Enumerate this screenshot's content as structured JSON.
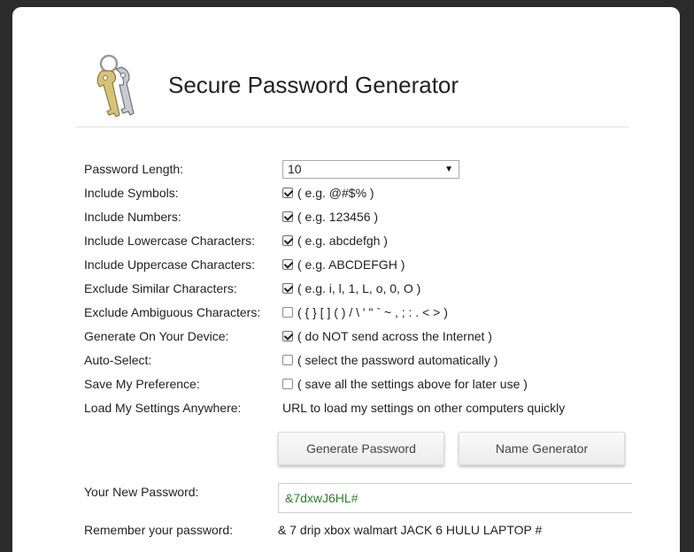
{
  "app": {
    "title": "Secure Password Generator"
  },
  "settings": [
    {
      "label": "Password Length:",
      "type": "select",
      "value": "10"
    },
    {
      "label": "Include Symbols:",
      "type": "checkbox",
      "checked": true,
      "hint": "( e.g. @#$% )"
    },
    {
      "label": "Include Numbers:",
      "type": "checkbox",
      "checked": true,
      "hint": "( e.g. 123456 )"
    },
    {
      "label": "Include Lowercase Characters:",
      "type": "checkbox",
      "checked": true,
      "hint": "( e.g. abcdefgh )"
    },
    {
      "label": "Include Uppercase Characters:",
      "type": "checkbox",
      "checked": true,
      "hint": "( e.g. ABCDEFGH )"
    },
    {
      "label": "Exclude Similar Characters:",
      "type": "checkbox",
      "checked": true,
      "hint": "( e.g. i, l, 1, L, o, 0, O )"
    },
    {
      "label": "Exclude Ambiguous Characters:",
      "type": "checkbox",
      "checked": false,
      "hint": "( { } [ ] ( ) / \\ ' \" ` ~ , ; : . < > )"
    },
    {
      "label": "Generate On Your Device:",
      "type": "checkbox",
      "checked": true,
      "hint": "( do NOT send across the Internet )"
    },
    {
      "label": "Auto-Select:",
      "type": "checkbox",
      "checked": false,
      "hint": "( select the password automatically )"
    },
    {
      "label": "Save My Preference:",
      "type": "checkbox",
      "checked": false,
      "hint": "( save all the settings above for later use )"
    },
    {
      "label": "Load My Settings Anywhere:",
      "type": "text",
      "hint": "URL to load my settings on other computers quickly"
    }
  ],
  "buttons": {
    "generate": "Generate Password",
    "name_generator": "Name Generator"
  },
  "result": {
    "new_password_label": "Your New Password:",
    "new_password_value": "&7dxwJ6HL#",
    "remember_label": "Remember your password:",
    "remember_value": "& 7 drip xbox walmart JACK 6 HULU LAPTOP #"
  },
  "colors": {
    "page_background": "#2b2b2b",
    "card_background": "#ffffff",
    "password_text": "#2f7d2f"
  },
  "icons": {
    "logo": "keys-icon",
    "select_arrow": "triangle-down-icon",
    "checkbox": "checkmark-icon"
  }
}
